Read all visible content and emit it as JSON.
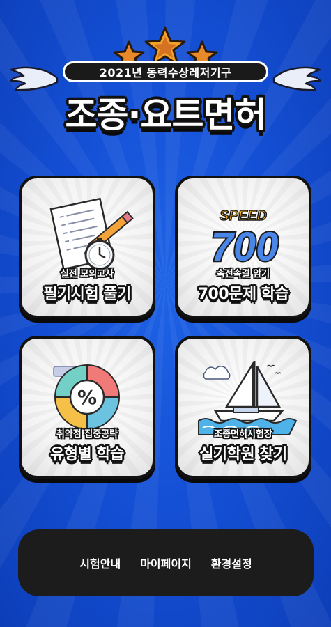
{
  "header": {
    "subtitle": "2021년 동력수상레저기구",
    "title": "조종·요트면허"
  },
  "cards": [
    {
      "small": "실전 모의고사",
      "big": "필기시험 풀기"
    },
    {
      "small": "속전속결 암기",
      "big": "700문제 학습",
      "badge_top": "SPEED",
      "badge_num": "700"
    },
    {
      "small": "취약점 집중공략",
      "big": "유형별 학습"
    },
    {
      "small": "조종면허시험장",
      "big": "실기학원 찾기"
    }
  ],
  "bottom_nav": {
    "items": [
      "시험안내",
      "마이페이지",
      "환경설정"
    ]
  },
  "colors": {
    "background": "#1450d6",
    "card_border": "#111111",
    "bottom_bar": "#1c1c1c",
    "star": "#f39a1e",
    "speed_blue": "#2d6be0"
  }
}
